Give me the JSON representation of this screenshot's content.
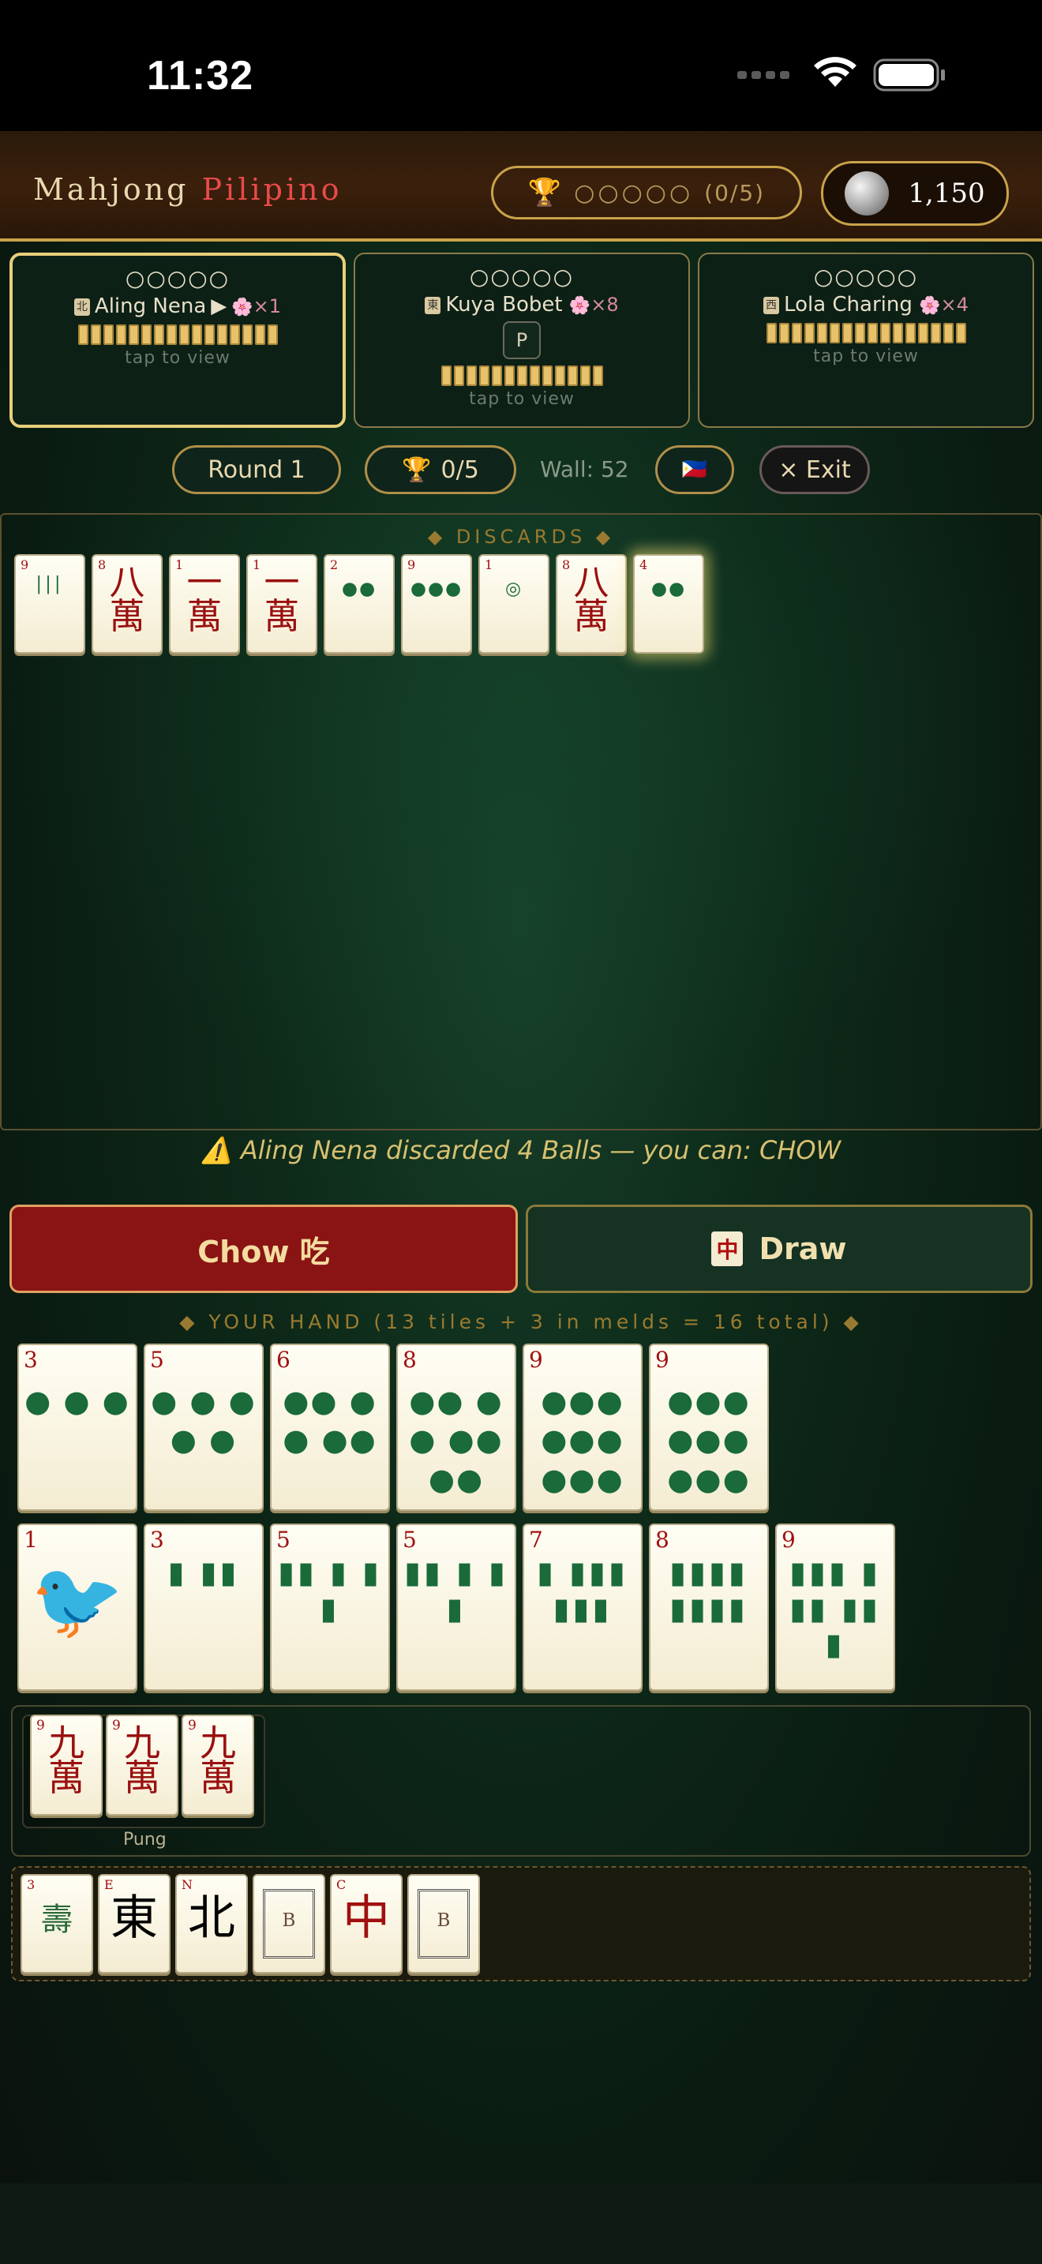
{
  "status": {
    "time": "11:32"
  },
  "header": {
    "brand_part1": "Mahjong",
    "brand_part2": "Pilipino",
    "trophy_circles": "○○○○○",
    "trophy_count": "(0/5)",
    "coins": "1,150"
  },
  "opponents": [
    {
      "circles": "○○○○○",
      "wind": "北",
      "name": "Aling Nena",
      "turn_marker": "▶",
      "flower_icon": "🌸",
      "flower_count": "×1",
      "tiles": 16,
      "tap": "tap to view",
      "active": true,
      "badge": ""
    },
    {
      "circles": "○○○○○",
      "wind": "東",
      "name": "Kuya Bobet",
      "turn_marker": "",
      "flower_icon": "🌸",
      "flower_count": "×8",
      "tiles": 13,
      "tap": "tap to view",
      "active": false,
      "badge": "P"
    },
    {
      "circles": "○○○○○",
      "wind": "西",
      "name": "Lola Charing",
      "turn_marker": "",
      "flower_icon": "🌸",
      "flower_count": "×4",
      "tiles": 16,
      "tap": "tap to view",
      "active": false,
      "badge": ""
    }
  ],
  "controls": {
    "round": "Round 1",
    "trophy": "0/5",
    "wall": "Wall: 52",
    "flag": "🇵🇭",
    "exit": "× Exit"
  },
  "discards": {
    "label": "◆ DISCARDS ◆",
    "tiles": [
      {
        "num": "9",
        "kind": "bamboo",
        "glyph": "|||"
      },
      {
        "num": "8",
        "kind": "char",
        "glyph": "八萬"
      },
      {
        "num": "1",
        "kind": "char",
        "glyph": "一萬"
      },
      {
        "num": "1",
        "kind": "char",
        "glyph": "一萬"
      },
      {
        "num": "2",
        "kind": "dots",
        "glyph": "●●"
      },
      {
        "num": "9",
        "kind": "dots",
        "glyph": "●●●"
      },
      {
        "num": "1",
        "kind": "dots",
        "glyph": "◎"
      },
      {
        "num": "8",
        "kind": "char",
        "glyph": "八萬"
      },
      {
        "num": "4",
        "kind": "dots",
        "glyph": "●●"
      }
    ]
  },
  "message": "⚠️ Aling Nena discarded 4 Balls — you can: CHOW",
  "actions": {
    "chow": "Chow 吃",
    "draw_icon": "中",
    "draw": "Draw"
  },
  "hand": {
    "label": "◆ YOUR HAND (13 tiles + 3 in melds = 16 total) ◆",
    "row1": [
      {
        "num": "3",
        "kind": "dots",
        "glyph": "● ● ●"
      },
      {
        "num": "5",
        "kind": "dots",
        "glyph": "● ● ● ● ●"
      },
      {
        "num": "6",
        "kind": "dots",
        "glyph": "●● ●● ●●"
      },
      {
        "num": "8",
        "kind": "dots",
        "glyph": "●● ●● ●● ●●"
      },
      {
        "num": "9",
        "kind": "dots",
        "glyph": "●●● ●●● ●●●"
      },
      {
        "num": "9",
        "kind": "dots",
        "glyph": "●●● ●●● ●●●"
      }
    ],
    "row2": [
      {
        "num": "1",
        "kind": "bird",
        "glyph": "🐦"
      },
      {
        "num": "3",
        "kind": "bamboo",
        "glyph": "▮ ▮▮"
      },
      {
        "num": "5",
        "kind": "bamboo",
        "glyph": "▮▮ ▮ ▮▮"
      },
      {
        "num": "5",
        "kind": "bamboo",
        "glyph": "▮▮ ▮ ▮▮"
      },
      {
        "num": "7",
        "kind": "bamboo",
        "glyph": "▮ ▮▮▮ ▮▮▮"
      },
      {
        "num": "8",
        "kind": "bamboo",
        "glyph": "▮▮▮▮ ▮▮▮▮"
      },
      {
        "num": "9",
        "kind": "bamboo",
        "glyph": "▮▮▮ ▮▮▮ ▮▮▮"
      }
    ],
    "meld": {
      "label": "Pung",
      "tiles": [
        {
          "num": "9",
          "glyph": "九萬"
        },
        {
          "num": "9",
          "glyph": "九萬"
        },
        {
          "num": "9",
          "glyph": "九萬"
        }
      ]
    },
    "flowers": [
      {
        "num": "3",
        "kind": "flower",
        "glyph": "壽"
      },
      {
        "num": "E",
        "kind": "wind",
        "glyph": "東"
      },
      {
        "num": "N",
        "kind": "wind",
        "glyph": "北"
      },
      {
        "num": "",
        "kind": "blank",
        "glyph": "B"
      },
      {
        "num": "C",
        "kind": "dragon",
        "glyph": "中"
      },
      {
        "num": "",
        "kind": "blank",
        "glyph": "B"
      }
    ]
  },
  "colors": {
    "accent_gold": "#c9a24a",
    "chow_red": "#8a1414",
    "felt_green": "#0d2818"
  }
}
